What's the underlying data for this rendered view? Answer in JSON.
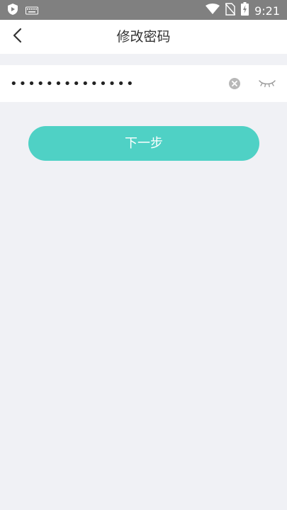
{
  "status_bar": {
    "time": "9:21",
    "icons": [
      "shield-app-icon",
      "keyboard-icon",
      "wifi-icon",
      "no-sim-icon",
      "battery-charging-icon"
    ]
  },
  "app_bar": {
    "title": "修改密码",
    "back_icon": "chevron-left-icon"
  },
  "password_field": {
    "value": "••••••••••••••",
    "clear_icon": "clear-circle-icon",
    "toggle_icon": "eye-closed-icon"
  },
  "next_button": {
    "label": "下一步",
    "color": "#4fd1c5"
  },
  "colors": {
    "background": "#f0f1f5",
    "status_bar": "#808080",
    "accent": "#4fd1c5"
  }
}
